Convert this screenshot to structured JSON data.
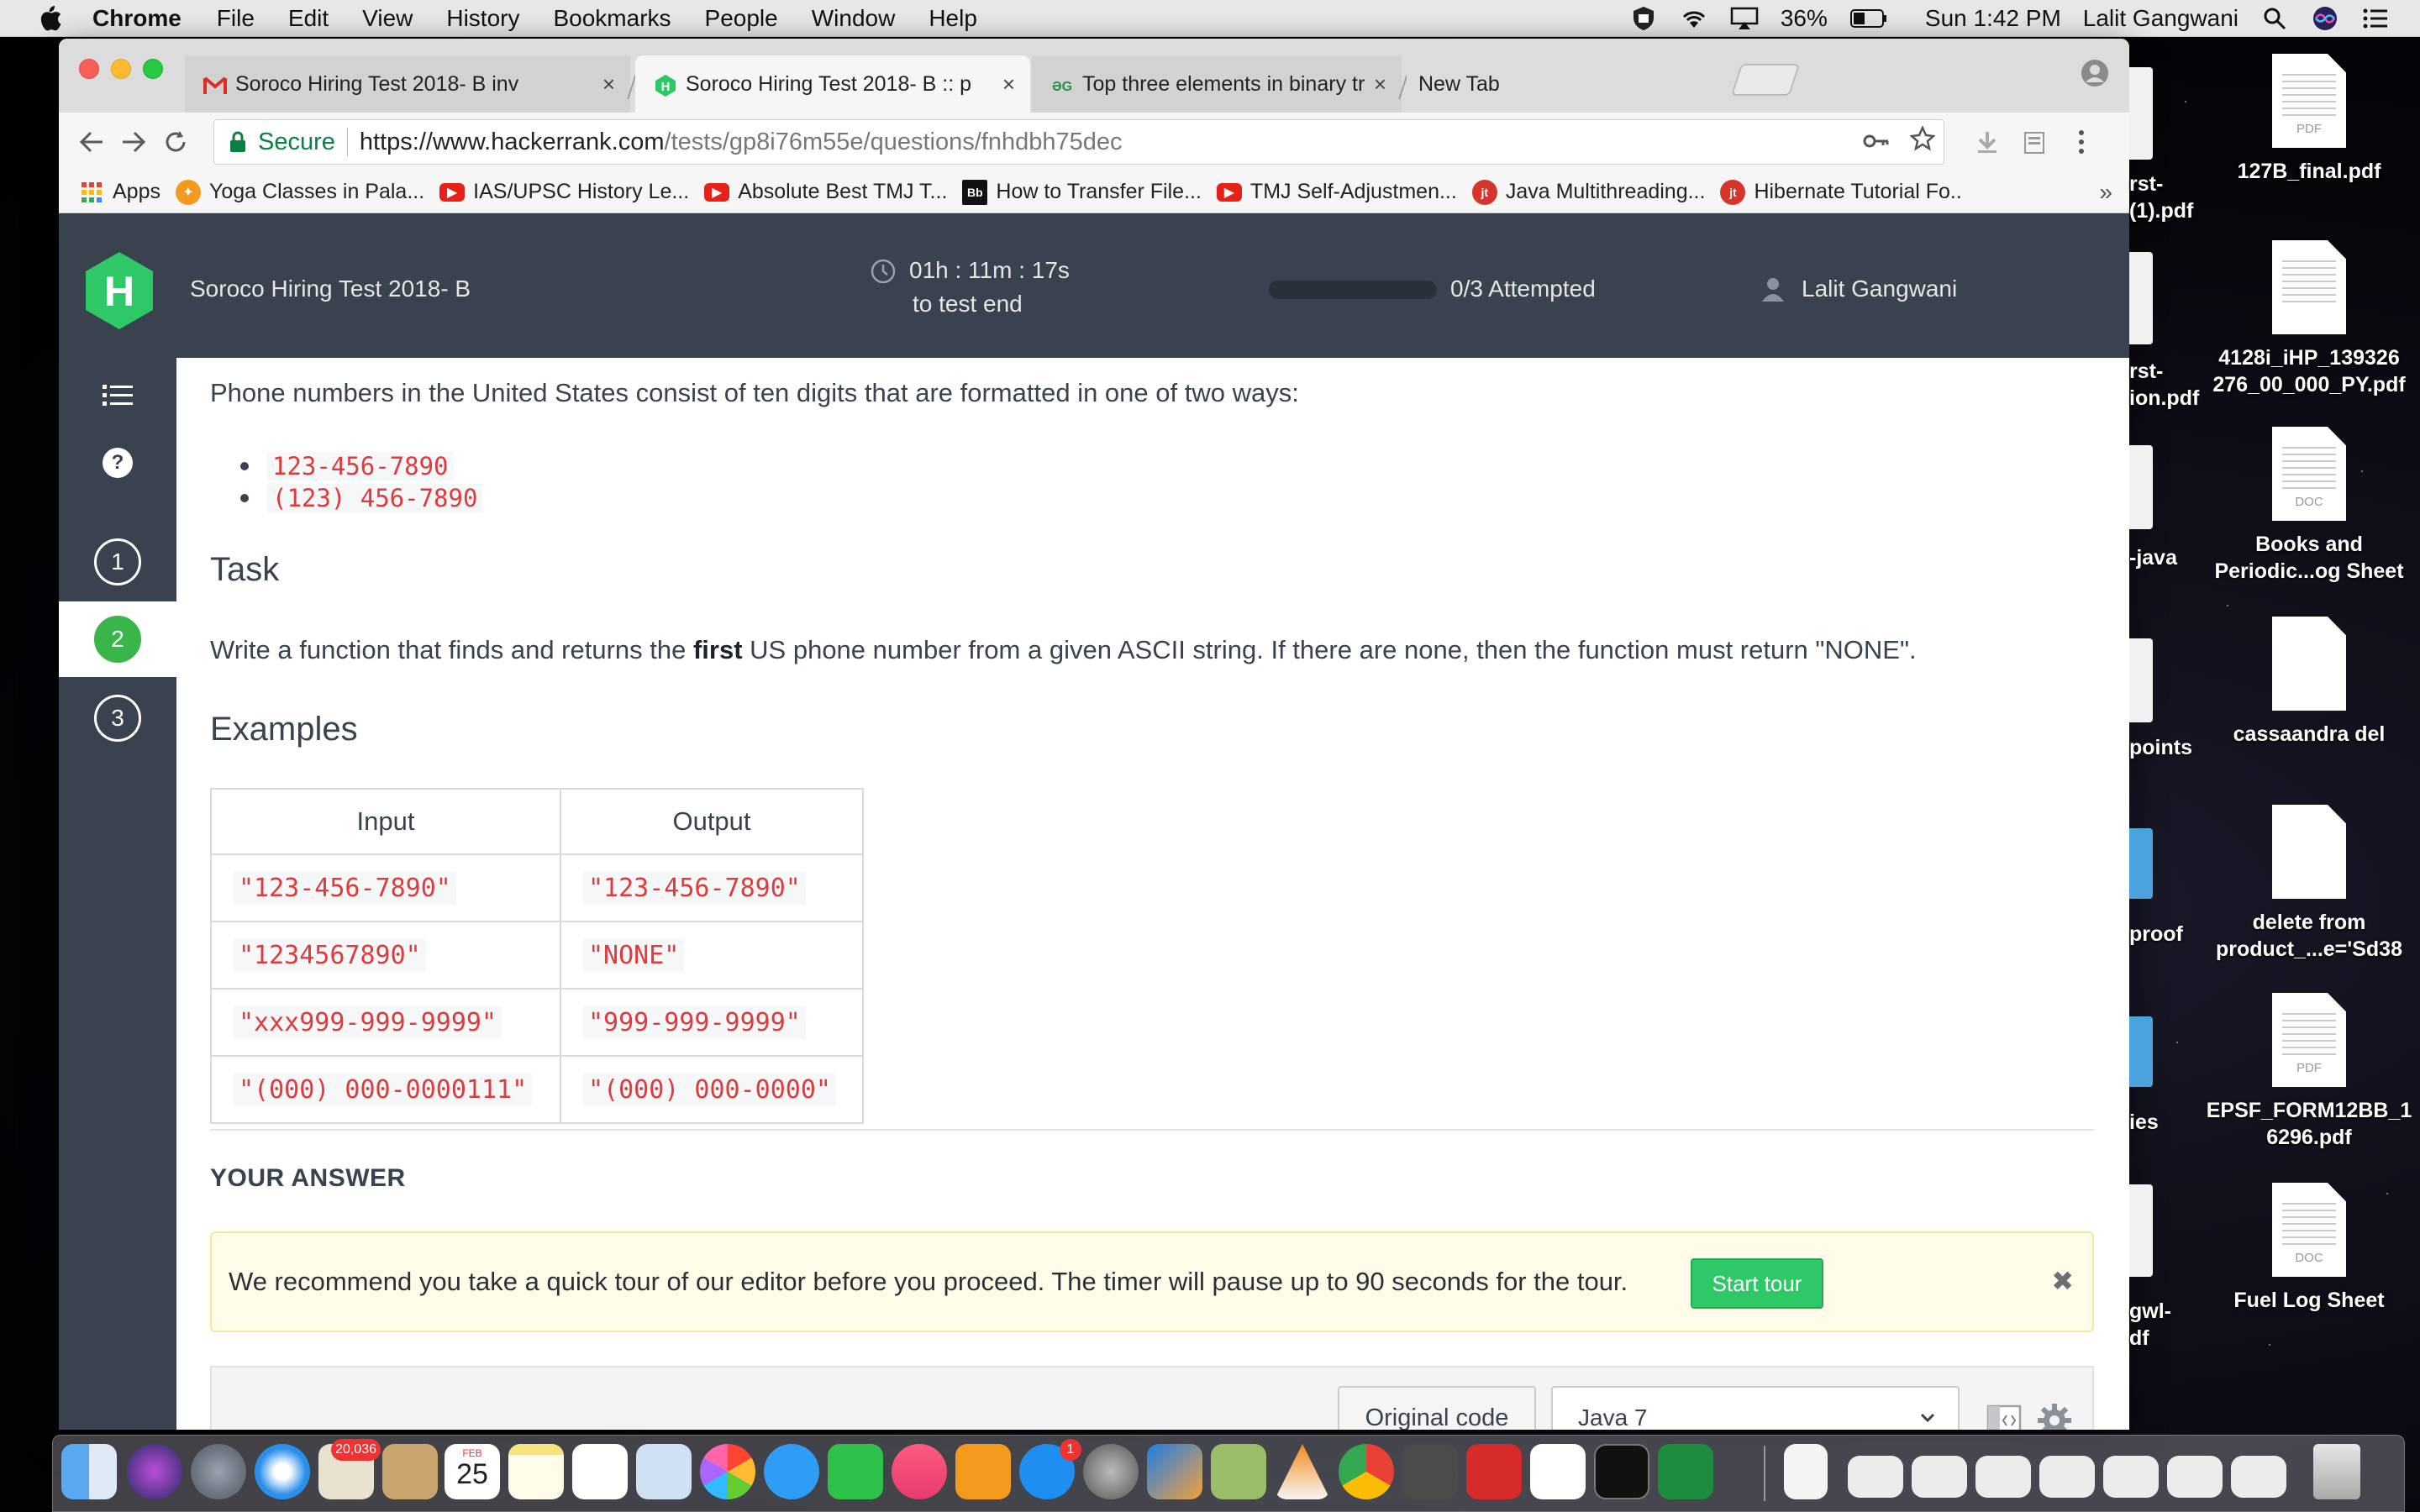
{
  "menubar": {
    "app_name": "Chrome",
    "menus": [
      "File",
      "Edit",
      "View",
      "History",
      "Bookmarks",
      "People",
      "Window",
      "Help"
    ],
    "battery": "36%",
    "clock": "Sun 1:42 PM",
    "user": "Lalit Gangwani"
  },
  "browser": {
    "tabs": [
      {
        "title": "Soroco Hiring Test 2018- B inv",
        "icon": "gmail-icon"
      },
      {
        "title": "Soroco Hiring Test 2018- B :: p",
        "icon": "hackerrank-icon"
      },
      {
        "title": "Top three elements in binary tr",
        "icon": "geeksforgeeks-icon"
      },
      {
        "title": "New Tab",
        "icon": ""
      }
    ],
    "address": {
      "secure_label": "Secure",
      "url_host": "https://www.hackerrank.com",
      "url_path": "/tests/gp8i76m55e/questions/fnhdbh75dec"
    },
    "bookmarks": [
      {
        "label": "Apps",
        "icon": "apps-grid-icon",
        "color": "#e94235"
      },
      {
        "label": "Yoga Classes in Pala...",
        "icon": "yoga-icon",
        "color": "#f29a1f"
      },
      {
        "label": "IAS/UPSC History Le...",
        "icon": "youtube-icon",
        "color": "#e62117"
      },
      {
        "label": "Absolute Best TMJ T...",
        "icon": "youtube-icon",
        "color": "#e62117"
      },
      {
        "label": "How to Transfer File...",
        "icon": "bb-icon",
        "color": "#111111"
      },
      {
        "label": "TMJ Self-Adjustmen...",
        "icon": "youtube-icon",
        "color": "#e62117"
      },
      {
        "label": "Java Multithreading...",
        "icon": "javatpoint-icon",
        "color": "#d7352b"
      },
      {
        "label": "Hibernate Tutorial Fo..",
        "icon": "javatpoint-icon",
        "color": "#d7352b"
      }
    ],
    "bookmarks_more": "»"
  },
  "hackerrank": {
    "logo_letter": "H",
    "test_title": "Soroco Hiring Test 2018- B",
    "timer": "01h : 11m : 17s",
    "timer_sub": "to test end",
    "progress_fraction": 0,
    "attempted": "0/3 Attempted",
    "user": "Lalit Gangwani",
    "sidebar": {
      "help": "?",
      "questions": [
        "1",
        "2",
        "3"
      ],
      "active_question": "2"
    }
  },
  "question": {
    "intro": "Phone numbers in the United States consist of ten digits that are formatted in one of two ways:",
    "formats": [
      "123-456-7890",
      "(123) 456-7890"
    ],
    "task_heading": "Task",
    "task_before": "Write a function that finds and returns the ",
    "task_bold": "first",
    "task_after": " US phone number from a given ASCII string. If there are none, then the function must return \"NONE\".",
    "examples_heading": "Examples",
    "table_headers": [
      "Input",
      "Output"
    ],
    "table_rows": [
      [
        "\"123-456-7890\"",
        "\"123-456-7890\""
      ],
      [
        "\"1234567890\"",
        "\"NONE\""
      ],
      [
        "\"xxx999-999-9999\"",
        "\"999-999-9999\""
      ],
      [
        "\"(000) 000-0000111\"",
        "\"(000) 000-0000\""
      ]
    ]
  },
  "answer": {
    "heading": "YOUR ANSWER",
    "tour_text": "We recommend you take a quick tour of our editor before you proceed. The timer will pause up to 90 seconds for the tour.",
    "tour_button": "Start tour",
    "tour_close": "✖",
    "original_code_button": "Original code",
    "language": "Java 7"
  },
  "desktop": {
    "items": [
      {
        "label": "127B_final.pdf",
        "kind": "PDF"
      },
      {
        "label": "4128i_iHP_139326 276_00_000_PY.pdf",
        "kind": ""
      },
      {
        "label": "Books and Periodic...og Sheet",
        "kind": "DOC"
      },
      {
        "label": "cassaandra del",
        "kind": ""
      },
      {
        "label": "delete from product_...e='Sd38",
        "kind": ""
      },
      {
        "label": "EPSF_FORM12BB_1 6296.pdf",
        "kind": "PDF"
      },
      {
        "label": "Fuel Log Sheet",
        "kind": "DOC"
      }
    ],
    "partial_labels": [
      "rst-",
      "(1).pdf",
      "rst-",
      "ion.pdf",
      "-java",
      "points",
      "proof",
      "ies",
      "gwl-",
      "df"
    ]
  },
  "dock": {
    "mail_badge": "20,036",
    "calendar_month": "FEB",
    "calendar_day": "25",
    "appstore_badge": "1"
  }
}
